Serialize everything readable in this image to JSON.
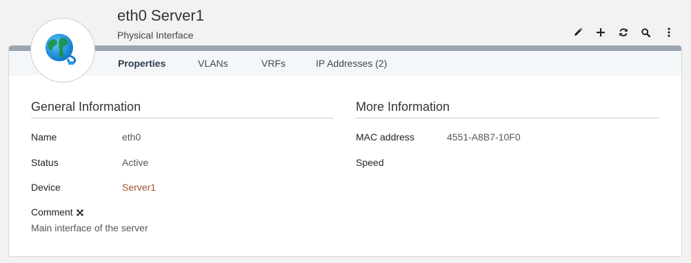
{
  "header": {
    "title": "eth0 Server1",
    "subtitle": "Physical Interface",
    "actions": [
      {
        "icon": "pencil-icon",
        "name": "edit"
      },
      {
        "icon": "plus-icon",
        "name": "add"
      },
      {
        "icon": "refresh-icon",
        "name": "refresh"
      },
      {
        "icon": "search-icon",
        "name": "search"
      },
      {
        "icon": "kebab-icon",
        "name": "more"
      }
    ]
  },
  "tabs": [
    "Properties",
    "VLANs",
    "VRFs",
    "IP Addresses (2)"
  ],
  "active_tab": "Properties",
  "general": {
    "title": "General Information",
    "name_label": "Name",
    "name_value": "eth0",
    "status_label": "Status",
    "status_value": "Active",
    "device_label": "Device",
    "device_value": "Server1",
    "comment_label": "Comment",
    "comment_value": "Main interface of the server"
  },
  "more": {
    "title": "More Information",
    "mac_label": "MAC address",
    "mac_value": "4551-A8B7-10F0",
    "speed_label": "Speed",
    "speed_value": ""
  },
  "colors": {
    "link": "#a1522a",
    "topbar": "#9aa5b1",
    "tabbar_bg": "#f4f7fa"
  }
}
